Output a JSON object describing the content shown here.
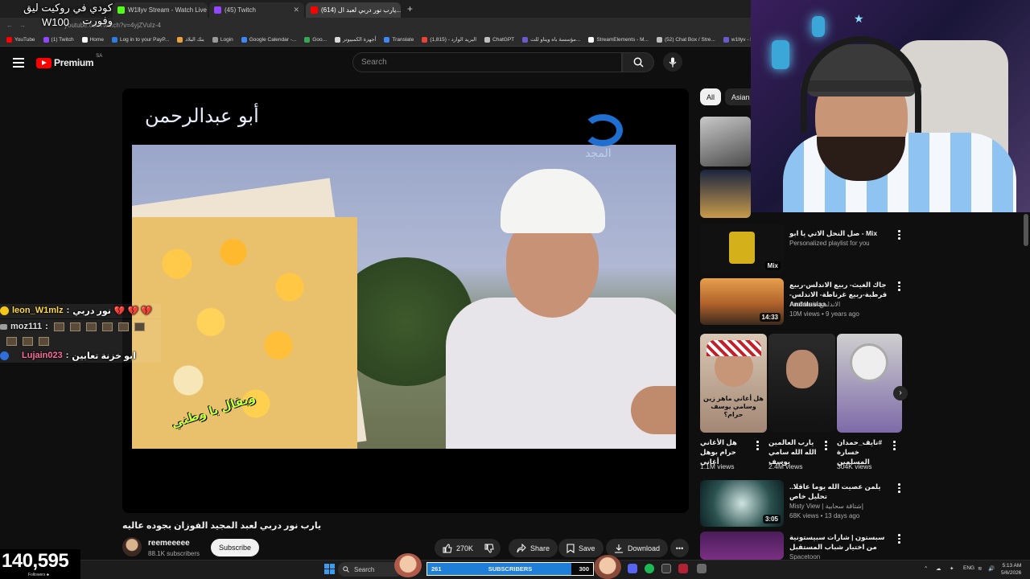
{
  "overlay": {
    "title": "كودي في روكيت ليق وفورت",
    "subtitle": "W100"
  },
  "browser": {
    "tabs": [
      {
        "label": "W1llyv Stream - Watch Live on...",
        "color": "#53fc18"
      },
      {
        "label": "(45) Twitch",
        "color": "#9146ff"
      },
      {
        "label": "(614) يارب نور دربي لعبد ال...",
        "color": "#ff0000",
        "active": true
      }
    ],
    "url": "youtube.com/watch?v=4yjZVuIz-4",
    "bookmarks": [
      {
        "label": "YouTube",
        "color": "#ff0000"
      },
      {
        "label": "(1) Twitch",
        "color": "#9146ff"
      },
      {
        "label": "Home",
        "color": "#ffffff"
      },
      {
        "label": "Log in to your PayP...",
        "color": "#2a7de1"
      },
      {
        "label": "بنك البلاد",
        "color": "#e8a33a"
      },
      {
        "label": "Login",
        "color": "#9a9a9a"
      },
      {
        "label": "Google Calendar -...",
        "color": "#4285f4"
      },
      {
        "label": "Goo...",
        "color": "#34a853"
      },
      {
        "label": "أجهزة الكمبيوتر",
        "color": "#d9d9d9"
      },
      {
        "label": "Translate",
        "color": "#4285f4"
      },
      {
        "label": "البريد الوارد - (1,815)",
        "color": "#ea4335"
      },
      {
        "label": "ChatGPT",
        "color": "#bfbfbf"
      },
      {
        "label": "مؤسسة باه ويناو للت...",
        "color": "#6a5acd"
      },
      {
        "label": "StreamElements - M...",
        "color": "#ffffff"
      },
      {
        "label": "(52) Chat Box / Stre...",
        "color": "#bfbfbf"
      },
      {
        "label": "w1llyv - Kick Stats...",
        "color": "#6a5acd"
      }
    ]
  },
  "youtube": {
    "logo_text": "Premium",
    "region": "SA",
    "search_placeholder": "Search",
    "video_title": "يارب نور دربي لعبد المجيد الفوزان بجوده عاليه",
    "video_overlay": {
      "top_left": "أبو عبدالرحمن",
      "channel_mark": "المجد",
      "stamp": "ويقال يا وطني"
    },
    "channel": "reemeeeee",
    "subscribers": "88.1K subscribers",
    "subscribe_label": "Subscribe",
    "likes": "270K",
    "share_label": "Share",
    "save_label": "Save",
    "download_label": "Download",
    "chips": [
      "All",
      "Asian"
    ],
    "recommendations": [
      {
        "title": "Mix - صل النحل الاتي يا ابو",
        "meta1": "Personalized playlist for you",
        "badge": "Mix"
      },
      {
        "title": "جاك الغيث- ربيع الاندلس-ربيع قرطبة-ربيع غرناطة- الاندلس- Andalusiaa",
        "meta1": "Andalusia الاندلس",
        "meta2": "10M views • 9 years ago",
        "duration": "14:33"
      },
      {
        "title": "يلمن عصيت الله يوما عاقلا.. تحليل خاص",
        "meta1": "Misty View | إشتاقة سحابية",
        "meta2": "68K views • 13 days ago",
        "duration": "3:05"
      },
      {
        "title": "سبستون | شارات سبيستونية من اختيار شباب المستقبل",
        "meta1": "Spacetoon"
      }
    ],
    "shorts": [
      {
        "title": "هل الأغاني حرام بوهل أغاني",
        "views": "1.1M views",
        "caption": "هل أغاني ماهر زين وسامي يوسف حرام؟"
      },
      {
        "title": "يارب العالمين الله الله سامي يوسف",
        "views": "2.4M views"
      },
      {
        "title": "#نايف_حمدان خسارة المسلمين",
        "views": "304K views"
      }
    ]
  },
  "chat": [
    {
      "user": "leon_W1mlz",
      "user_color": "#ffd84a",
      "message": "نور دربي",
      "badge_color": "#f5c518"
    },
    {
      "user": "moz111",
      "user_color": "#e0e0e0",
      "message": "",
      "badge_color": "#9e9e9e"
    },
    {
      "user": "Lujain023",
      "user_color": "#ff6b9e",
      "message": "ابو خزنة تعابين",
      "badge_color": "#2f6fdb"
    }
  ],
  "followers": {
    "count": "140,595",
    "label": "Followers ♣"
  },
  "taskbar": {
    "search_label": "Search",
    "subgoal": {
      "current": "261",
      "label": "SUBSCRIBERS",
      "target": "300",
      "progress": 0.87
    },
    "lang": "ENG",
    "time": "5:13 AM",
    "date": "5/6/2026"
  }
}
